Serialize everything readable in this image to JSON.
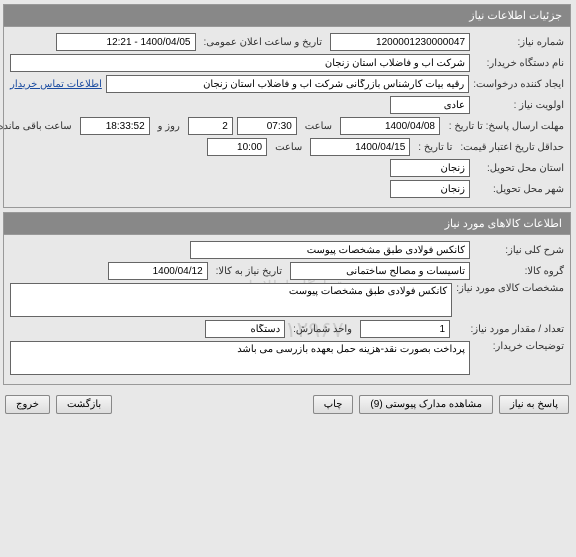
{
  "panel1": {
    "title": "جزئیات اطلاعات نیاز",
    "labels": {
      "need_no": "شماره نیاز:",
      "publish_datetime": "تاریخ و ساعت اعلان عمومی:",
      "buyer_org": "نام دستگاه خریدار:",
      "request_creator": "ایجاد کننده درخواست:",
      "contact_link": "اطلاعات تماس خریدار",
      "priority": "اولویت نیاز :",
      "deadline": "مهلت ارسال پاسخ:  تا تاریخ :",
      "time_lbl": "ساعت",
      "days_lbl": "روز و",
      "remain_lbl": "ساعت باقی مانده",
      "min_validity": "حداقل تاریخ اعتبار قیمت:",
      "to_date": "تا تاریخ :",
      "delivery_province": "استان محل تحویل:",
      "delivery_city": "شهر محل تحویل:"
    },
    "values": {
      "need_no": "1200001230000047",
      "publish_datetime": "1400/04/05 - 12:21",
      "buyer_org": "شرکت آب و فاضلاب استان زنجان",
      "request_creator": "رقیه بیات کارشناس بازرگانی شرکت آب و فاضلاب استان زنجان",
      "priority": "عادی",
      "deadline_date": "1400/04/08",
      "deadline_time": "07:30",
      "remain_days": "2",
      "remain_time": "18:33:52",
      "validity_date": "1400/04/15",
      "validity_time": "10:00",
      "delivery_province": "زنجان",
      "delivery_city": "زنجان"
    }
  },
  "panel2": {
    "title": "اطلاعات کالاهای مورد نیاز",
    "labels": {
      "general_desc": "شرح کلی نیاز:",
      "goods_group": "گروه کالا:",
      "need_by_date": "تاریخ نیاز به کالا:",
      "goods_spec": "مشخصات کالای مورد نیاز:",
      "qty": "تعداد / مقدار مورد نیاز:",
      "unit": "واحد شمارش:",
      "buyer_notes": "توضیحات خریدار:"
    },
    "values": {
      "general_desc": "کانکس فولادی طبق مشخصات پیوست",
      "goods_group": "تاسیسات و مصالح ساختمانی",
      "need_by_date": "1400/04/12",
      "goods_spec": "کانکس فولادی طبق مشخصات پیوست",
      "qty": "1",
      "unit": "دستگاه",
      "buyer_notes": "پرداخت بصورت نقد-هزینه حمل بعهده بازرسی می باشد"
    },
    "watermark_line1": "قرارگاه اطلاعاتی",
    "watermark_line2": "مرکز توسعه تجارت الکترونیکی",
    "watermark_line3": "۰۲۱-۸۸۱۲۹۶۷۰"
  },
  "buttons": {
    "respond": "پاسخ به نیاز",
    "attachments": "مشاهده مدارک پیوستی (9)",
    "print": "چاپ",
    "back": "بازگشت",
    "exit": "خروج"
  }
}
